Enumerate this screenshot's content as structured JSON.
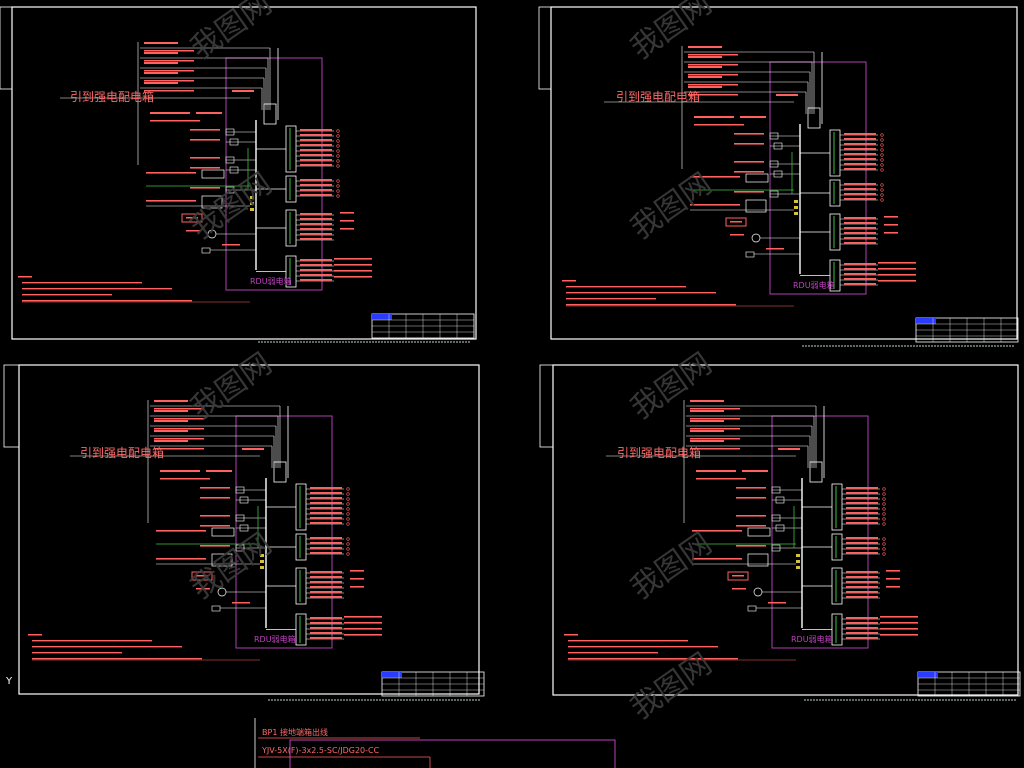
{
  "sheets": [
    {
      "feed_label": "引到强电配电箱",
      "box_label": "RDU弱电箱"
    },
    {
      "feed_label": "引到强电配电箱",
      "box_label": "RDU弱电箱"
    },
    {
      "feed_label": "引到强电配电箱",
      "box_label": "RDU弱电箱"
    },
    {
      "feed_label": "引到强电配电箱",
      "box_label": "RDU弱电箱"
    }
  ],
  "bottom_sheet": {
    "line1": "BP1 接地端箱出线",
    "line2": "YJV-5X(F)-3x2.5-SC/JDG20-CC"
  },
  "watermark": "我图网",
  "axis_marker": "Y",
  "colors": {
    "background": "#000000",
    "frame": "#ffffff",
    "box": "#b040b0",
    "wire_red": "#ff6060",
    "wire_green": "#40c040",
    "wire_cyan": "#40c0c0",
    "text_red": "#ff6a6a",
    "watermark": "#3c3c3c"
  }
}
